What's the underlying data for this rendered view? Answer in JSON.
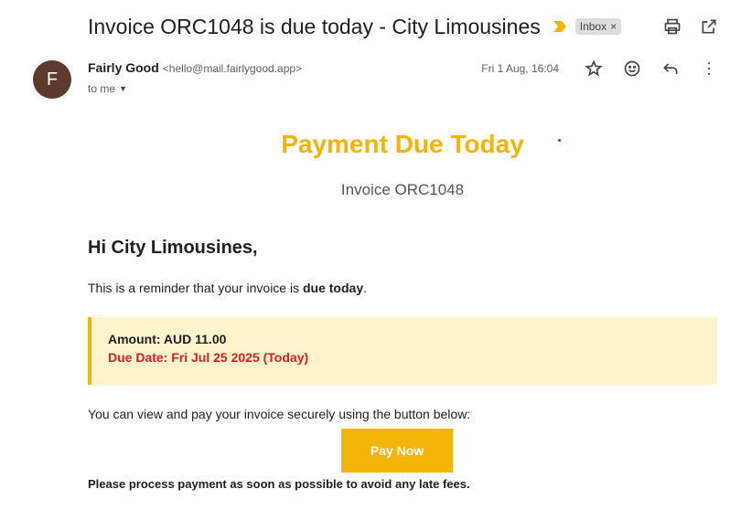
{
  "email": {
    "subject": "Invoice ORC1048 is due today - City Limousines",
    "label": "Inbox",
    "label_remove": "×",
    "sender": {
      "initial": "F",
      "name": "Fairly Good",
      "email": "<hello@mail.fairlygood.app>"
    },
    "recipient": "to me",
    "date": "Fri 1 Aug, 16:04"
  },
  "body": {
    "title": "Payment Due Today",
    "invoice_label": "Invoice ORC1048",
    "greeting": "Hi City Limousines,",
    "reminder_prefix": "This is a reminder that your invoice is ",
    "reminder_bold": "due today",
    "reminder_suffix": ".",
    "amount": "Amount: AUD 11.00",
    "due_date": "Due Date: Fri Jul 25 2025 (Today)",
    "pay_instruction": "You can view and pay your invoice securely using the button below:",
    "pay_button": "Pay Now",
    "closing": "Please process payment as soon as possible to avoid any late fees."
  },
  "colors": {
    "accent": "#f5b40a",
    "due_red": "#d91f1f",
    "amount_bg": "#fff3cc",
    "avatar": "#5d3a2b"
  },
  "icons": [
    "importance-marker-icon",
    "print-icon",
    "open-in-new-window-icon",
    "star-icon",
    "emoji-icon",
    "reply-icon",
    "more-options-icon",
    "dropdown-caret-icon"
  ]
}
